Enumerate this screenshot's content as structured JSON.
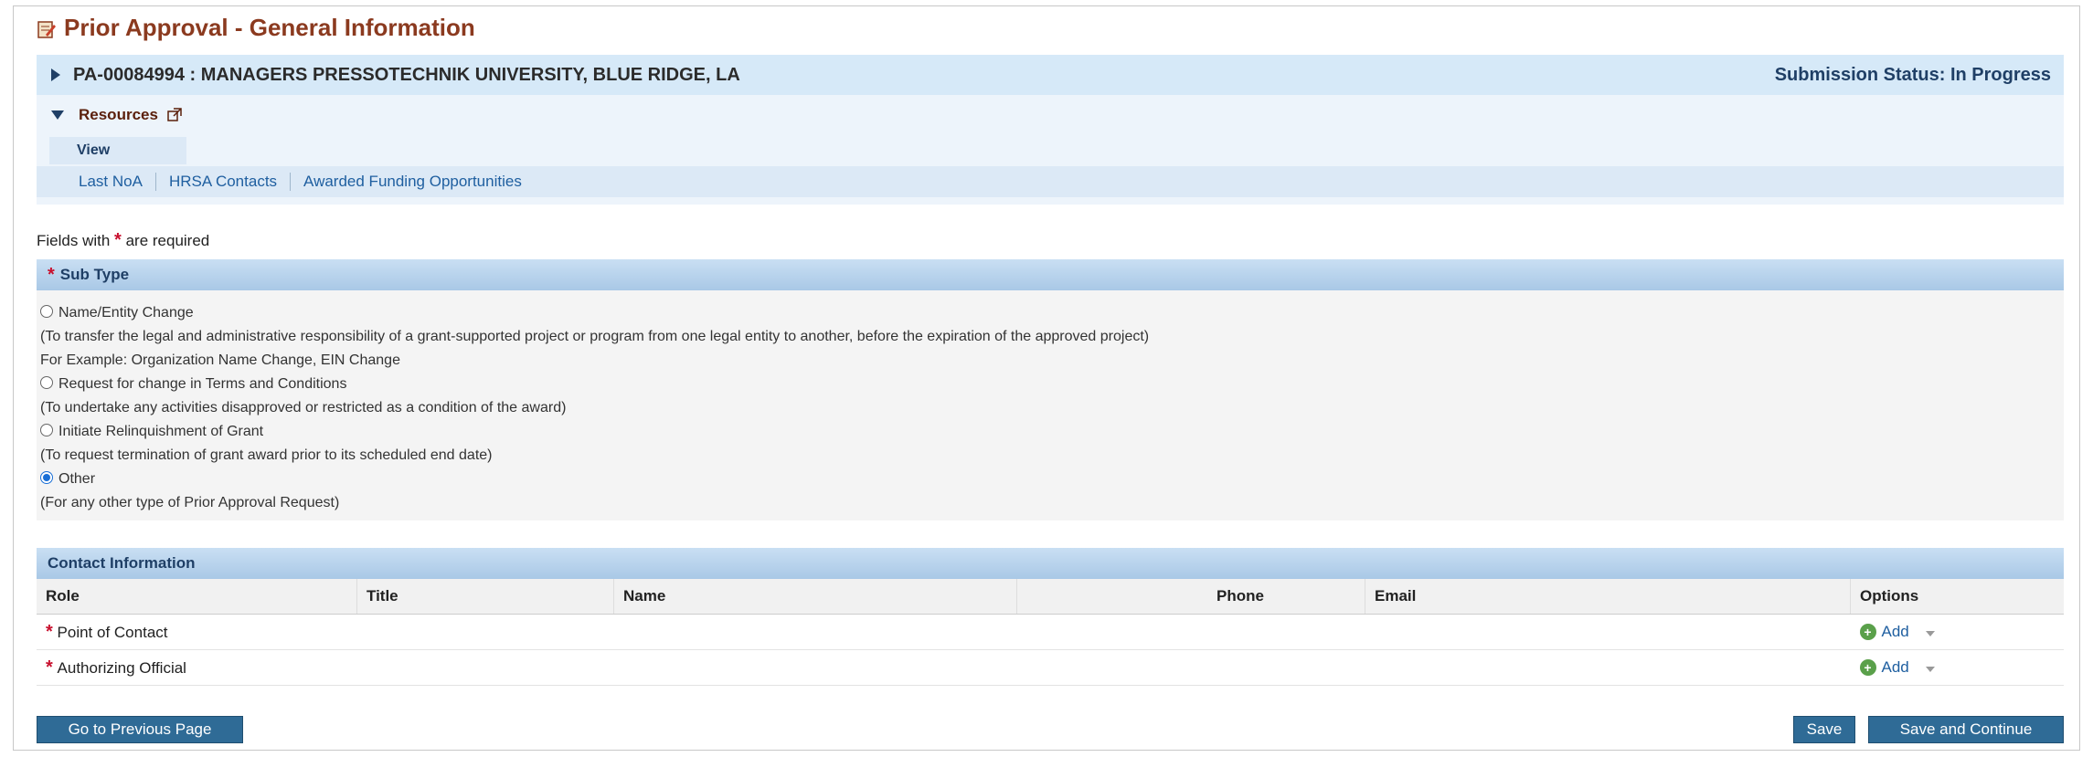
{
  "page": {
    "title": "Prior Approval - General Information"
  },
  "header": {
    "pa_text": "PA-00084994 : MANAGERS PRESSOTECHNIK UNIVERSITY, BLUE RIDGE, LA",
    "status": "Submission Status: In Progress"
  },
  "resources": {
    "label": "Resources",
    "view_tab": "View",
    "links": [
      "Last NoA",
      "HRSA Contacts",
      "Awarded Funding Opportunities"
    ]
  },
  "required_note": {
    "prefix": "Fields with",
    "suffix": "are required"
  },
  "subtype": {
    "header": "Sub Type",
    "lines": [
      "Name/Entity Change",
      "(To transfer the legal and administrative responsibility of a grant-supported project or program from one legal entity to another, before the expiration of the approved project)",
      "For Example: Organization Name Change, EIN Change",
      "Request for change in Terms and Conditions",
      "(To undertake any activities disapproved or restricted as a condition of the award)",
      "Initiate Relinquishment of Grant",
      "(To request termination of grant award prior to its scheduled end date)",
      "Other",
      "(For any other type of Prior Approval Request)"
    ],
    "selected": "Other"
  },
  "contact": {
    "header": "Contact Information",
    "columns": [
      "Role",
      "Title",
      "Name",
      "Phone",
      "Email",
      "Options"
    ],
    "rows": [
      {
        "role": "Point of Contact",
        "option": "Add"
      },
      {
        "role": "Authorizing Official",
        "option": "Add"
      }
    ]
  },
  "buttons": {
    "previous": "Go to Previous Page",
    "save": "Save",
    "save_continue": "Save and Continue"
  }
}
